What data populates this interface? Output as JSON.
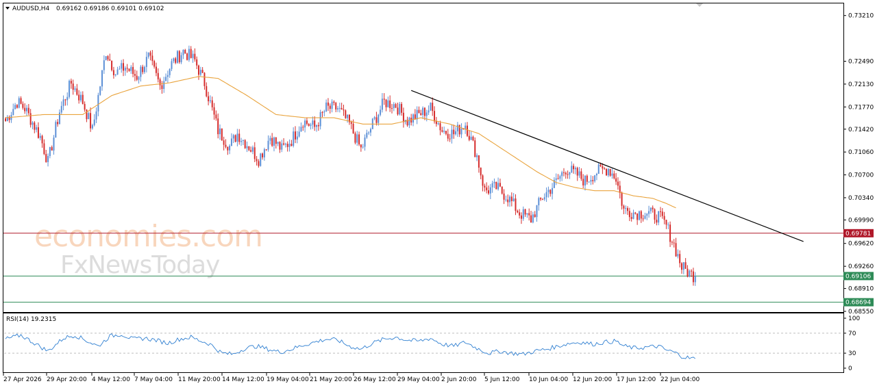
{
  "header": {
    "symbol": "AUDUSD,H4",
    "ohlc": "0.69162 0.69186 0.69101 0.69102"
  },
  "watermark": {
    "line1": "economies.com",
    "line2": "FxNewsToday"
  },
  "rsi_panel": {
    "label": "RSI(14) 19.2315",
    "levels": [
      "100",
      "70",
      "30",
      "0"
    ]
  },
  "colors": {
    "bull": "#5b8fd6",
    "bear": "#d52b2b",
    "ma": "#e9a33c",
    "resistance": "#b0182a",
    "support": "#2e8b57",
    "trendline": "#000000",
    "rsi": "#2f7fd1"
  },
  "chart_data": [
    {
      "type": "candlestick",
      "symbol": "AUDUSD",
      "timeframe": "H4",
      "ylim": [
        0.6855,
        0.7339
      ],
      "y_ticks": [
        "0.73210",
        "0.72490",
        "0.72130",
        "0.71770",
        "0.71420",
        "0.71060",
        "0.70700",
        "0.70340",
        "0.69990",
        "0.69620",
        "0.69260",
        "0.68910",
        "0.68550"
      ],
      "x_ticks": [
        "27 Apr 2026",
        "29 Apr 20:00",
        "4 May 12:00",
        "7 May 04:00",
        "11 May 20:00",
        "14 May 12:00",
        "19 May 04:00",
        "21 May 20:00",
        "26 May 12:00",
        "29 May 04:00",
        "2 Jun 20:00",
        "5 Jun 12:00",
        "10 Jun 04:00",
        "12 Jun 20:00",
        "17 Jun 12:00",
        "22 Jun 04:00"
      ],
      "waypoints": [
        [
          0,
          0.7155
        ],
        [
          6,
          0.7185
        ],
        [
          10,
          0.7175
        ],
        [
          18,
          0.713
        ],
        [
          22,
          0.709
        ],
        [
          28,
          0.717
        ],
        [
          34,
          0.7215
        ],
        [
          40,
          0.7185
        ],
        [
          45,
          0.714
        ],
        [
          52,
          0.7265
        ],
        [
          57,
          0.723
        ],
        [
          62,
          0.724
        ],
        [
          68,
          0.7225
        ],
        [
          74,
          0.7255
        ],
        [
          80,
          0.721
        ],
        [
          86,
          0.7245
        ],
        [
          92,
          0.7265
        ],
        [
          98,
          0.725
        ],
        [
          103,
          0.7215
        ],
        [
          110,
          0.714
        ],
        [
          116,
          0.7115
        ],
        [
          120,
          0.7135
        ],
        [
          126,
          0.7115
        ],
        [
          131,
          0.7095
        ],
        [
          137,
          0.713
        ],
        [
          143,
          0.711
        ],
        [
          148,
          0.7125
        ],
        [
          154,
          0.7155
        ],
        [
          160,
          0.7145
        ],
        [
          166,
          0.7175
        ],
        [
          172,
          0.7175
        ],
        [
          178,
          0.715
        ],
        [
          184,
          0.711
        ],
        [
          190,
          0.715
        ],
        [
          196,
          0.7185
        ],
        [
          202,
          0.718
        ],
        [
          208,
          0.7155
        ],
        [
          214,
          0.7165
        ],
        [
          220,
          0.7175
        ],
        [
          226,
          0.714
        ],
        [
          232,
          0.7135
        ],
        [
          238,
          0.715
        ],
        [
          244,
          0.71
        ],
        [
          248,
          0.7045
        ],
        [
          254,
          0.705
        ],
        [
          260,
          0.7035
        ],
        [
          266,
          0.701
        ],
        [
          272,
          0.7
        ],
        [
          278,
          0.7035
        ],
        [
          284,
          0.7055
        ],
        [
          290,
          0.708
        ],
        [
          296,
          0.707
        ],
        [
          300,
          0.706
        ],
        [
          306,
          0.7075
        ],
        [
          312,
          0.708
        ],
        [
          316,
          0.7065
        ],
        [
          320,
          0.7015
        ],
        [
          326,
          0.701
        ],
        [
          332,
          0.701
        ],
        [
          338,
          0.7005
        ],
        [
          342,
          0.699
        ],
        [
          346,
          0.696
        ],
        [
          350,
          0.6925
        ],
        [
          354,
          0.6915
        ],
        [
          357,
          0.691
        ]
      ],
      "n_candles": 358,
      "last_close": 0.69102,
      "moving_average_waypoints": [
        [
          0,
          0.716
        ],
        [
          20,
          0.7165
        ],
        [
          40,
          0.7165
        ],
        [
          55,
          0.7195
        ],
        [
          70,
          0.721
        ],
        [
          85,
          0.7215
        ],
        [
          100,
          0.7225
        ],
        [
          110,
          0.7222
        ],
        [
          125,
          0.7195
        ],
        [
          140,
          0.7165
        ],
        [
          155,
          0.716
        ],
        [
          170,
          0.716
        ],
        [
          185,
          0.715
        ],
        [
          200,
          0.715
        ],
        [
          215,
          0.716
        ],
        [
          230,
          0.715
        ],
        [
          245,
          0.7135
        ],
        [
          255,
          0.7115
        ],
        [
          265,
          0.7095
        ],
        [
          275,
          0.7075
        ],
        [
          285,
          0.7058
        ],
        [
          295,
          0.705
        ],
        [
          305,
          0.7045
        ],
        [
          315,
          0.7045
        ],
        [
          325,
          0.7037
        ],
        [
          335,
          0.7033
        ],
        [
          342,
          0.7025
        ],
        [
          347,
          0.7018
        ]
      ],
      "trendline": {
        "start": [
          210,
          0.7203
        ],
        "end": [
          413,
          0.6965
        ]
      },
      "horizontal_levels": [
        {
          "name": "resistance",
          "value": 0.69781,
          "label": "0.69781"
        },
        {
          "name": "current",
          "value": 0.69106,
          "label": "0.69106"
        },
        {
          "name": "support",
          "value": 0.68694,
          "label": "0.68694"
        }
      ]
    },
    {
      "type": "line",
      "title": "RSI(14) 19.2315",
      "ylim": [
        0,
        100
      ],
      "levels": [
        70,
        30
      ],
      "waypoints": [
        [
          0,
          58
        ],
        [
          8,
          66
        ],
        [
          15,
          50
        ],
        [
          22,
          34
        ],
        [
          30,
          60
        ],
        [
          36,
          66
        ],
        [
          42,
          55
        ],
        [
          48,
          44
        ],
        [
          54,
          64
        ],
        [
          60,
          68
        ],
        [
          66,
          58
        ],
        [
          72,
          60
        ],
        [
          78,
          56
        ],
        [
          84,
          50
        ],
        [
          90,
          58
        ],
        [
          96,
          62
        ],
        [
          100,
          56
        ],
        [
          106,
          48
        ],
        [
          112,
          30
        ],
        [
          118,
          28
        ],
        [
          124,
          40
        ],
        [
          130,
          44
        ],
        [
          136,
          38
        ],
        [
          142,
          32
        ],
        [
          148,
          38
        ],
        [
          154,
          46
        ],
        [
          160,
          52
        ],
        [
          166,
          58
        ],
        [
          172,
          56
        ],
        [
          178,
          44
        ],
        [
          184,
          38
        ],
        [
          190,
          50
        ],
        [
          196,
          58
        ],
        [
          202,
          62
        ],
        [
          208,
          56
        ],
        [
          214,
          54
        ],
        [
          220,
          60
        ],
        [
          226,
          48
        ],
        [
          232,
          44
        ],
        [
          238,
          52
        ],
        [
          244,
          40
        ],
        [
          250,
          30
        ],
        [
          256,
          34
        ],
        [
          262,
          30
        ],
        [
          268,
          28
        ],
        [
          274,
          34
        ],
        [
          280,
          38
        ],
        [
          286,
          44
        ],
        [
          292,
          50
        ],
        [
          298,
          52
        ],
        [
          304,
          48
        ],
        [
          310,
          52
        ],
        [
          316,
          54
        ],
        [
          320,
          44
        ],
        [
          326,
          40
        ],
        [
          332,
          42
        ],
        [
          338,
          44
        ],
        [
          342,
          36
        ],
        [
          346,
          32
        ],
        [
          350,
          24
        ],
        [
          354,
          20
        ],
        [
          357,
          19.2
        ]
      ]
    }
  ]
}
